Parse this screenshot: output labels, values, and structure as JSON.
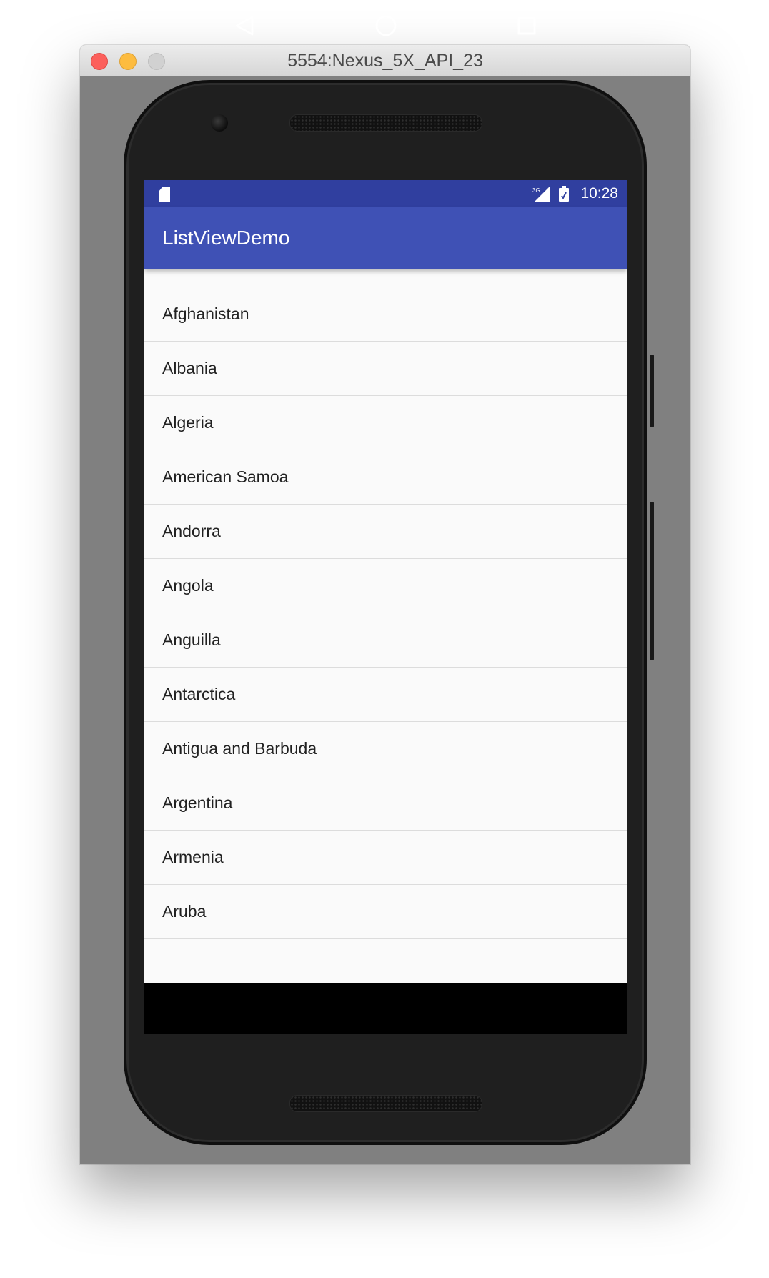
{
  "window": {
    "title": "5554:Nexus_5X_API_23"
  },
  "status_bar": {
    "time": "10:28",
    "icons": [
      "sd-card-icon",
      "signal-icon",
      "battery-icon"
    ]
  },
  "app_bar": {
    "title": "ListViewDemo",
    "color": "#3f51b5",
    "status_color": "#303f9f"
  },
  "list": {
    "items": [
      "Afghanistan",
      "Albania",
      "Algeria",
      "American Samoa",
      "Andorra",
      "Angola",
      "Anguilla",
      "Antarctica",
      "Antigua and Barbuda",
      "Argentina",
      "Armenia",
      "Aruba"
    ]
  },
  "nav_bar": {
    "buttons": [
      "back-icon",
      "home-icon",
      "recents-icon"
    ]
  }
}
